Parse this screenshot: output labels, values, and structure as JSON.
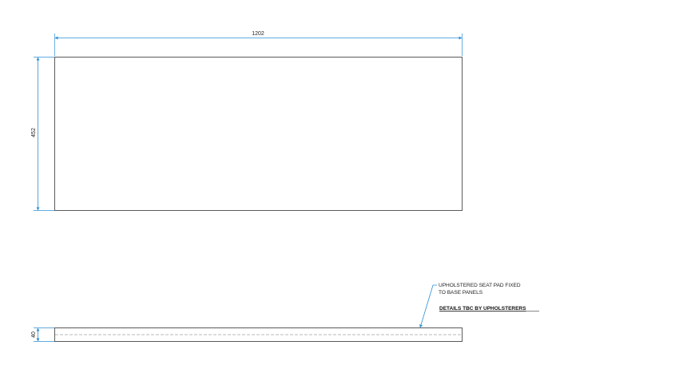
{
  "dimensions": {
    "width": "1202",
    "height": "452",
    "thickness": "40"
  },
  "annotation": {
    "line1": "UPHOLSTERED SEAT PAD FIXED",
    "line2": "TO BASE PANELS",
    "detail": "DETAILS TBC BY UPHOLSTERERS"
  },
  "colors": {
    "dimension_line": "#2b8fd6",
    "outline": "#333333"
  }
}
